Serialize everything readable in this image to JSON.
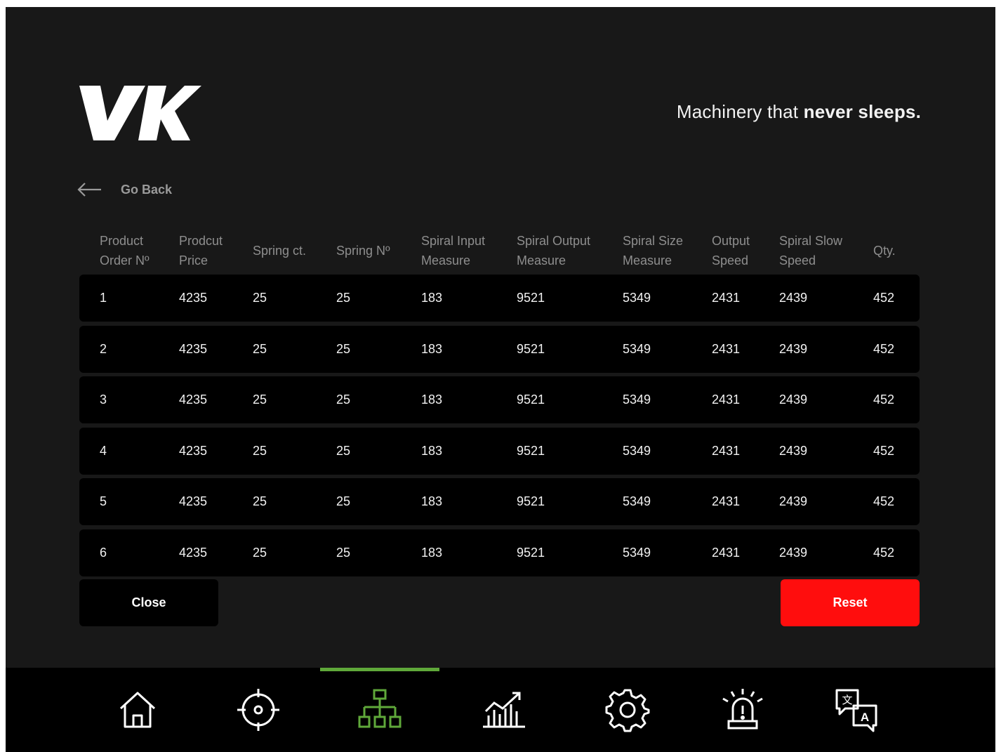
{
  "header": {
    "logo_text": "VK",
    "tagline_regular": "Machinery that ",
    "tagline_bold": "never sleeps."
  },
  "back": {
    "label": "Go Back"
  },
  "table": {
    "columns": [
      {
        "line1": "Product",
        "line2": "Order Nº"
      },
      {
        "line1": "Prodcut",
        "line2": "Price"
      },
      {
        "line1": "Spring ct.",
        "line2": ""
      },
      {
        "line1": "Spring Nº",
        "line2": ""
      },
      {
        "line1": "Spiral Input",
        "line2": "Measure"
      },
      {
        "line1": "Spiral Output",
        "line2": "Measure"
      },
      {
        "line1": "Spiral Size",
        "line2": "Measure"
      },
      {
        "line1": "Output",
        "line2": "Speed"
      },
      {
        "line1": "Spiral Slow",
        "line2": "Speed"
      },
      {
        "line1": "Qty.",
        "line2": ""
      }
    ],
    "rows": [
      [
        "1",
        "4235",
        "25",
        "25",
        "183",
        "9521",
        "5349",
        "2431",
        "2439",
        "452"
      ],
      [
        "2",
        "4235",
        "25",
        "25",
        "183",
        "9521",
        "5349",
        "2431",
        "2439",
        "452"
      ],
      [
        "3",
        "4235",
        "25",
        "25",
        "183",
        "9521",
        "5349",
        "2431",
        "2439",
        "452"
      ],
      [
        "4",
        "4235",
        "25",
        "25",
        "183",
        "9521",
        "5349",
        "2431",
        "2439",
        "452"
      ],
      [
        "5",
        "4235",
        "25",
        "25",
        "183",
        "9521",
        "5349",
        "2431",
        "2439",
        "452"
      ],
      [
        "6",
        "4235",
        "25",
        "25",
        "183",
        "9521",
        "5349",
        "2431",
        "2439",
        "452"
      ]
    ]
  },
  "actions": {
    "close_label": "Close",
    "reset_label": "Reset"
  },
  "nav": {
    "items": [
      {
        "icon": "home-icon"
      },
      {
        "icon": "target-icon"
      },
      {
        "icon": "hierarchy-icon",
        "active": true
      },
      {
        "icon": "analytics-chart-icon"
      },
      {
        "icon": "gear-icon"
      },
      {
        "icon": "alarm-siren-icon"
      },
      {
        "icon": "translate-icon"
      }
    ]
  },
  "colors": {
    "background": "#181818",
    "row": "#000000",
    "accent_green": "#5fa83a",
    "reset_red": "#ff0d0d"
  }
}
